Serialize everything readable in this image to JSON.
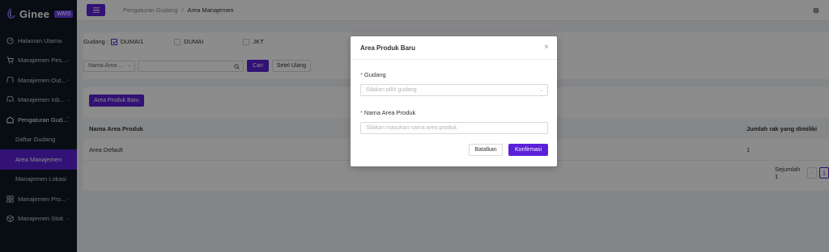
{
  "sidebar": {
    "logo": "Ginee",
    "badge": "WMS",
    "items": [
      {
        "label": "Halaman Utama",
        "icon": "dashboard-icon"
      },
      {
        "label": "Manajemen Pes...",
        "icon": "cart-icon"
      },
      {
        "label": "Manajemen Out...",
        "icon": "outbound-icon"
      },
      {
        "label": "Manajemen Inb...",
        "icon": "inbound-icon"
      },
      {
        "label": "Pengaturan Gud...",
        "icon": "warehouse-icon"
      }
    ],
    "subitems": [
      "Daftar Gudang",
      "Area Manajemen",
      "Manajemen Lokasi"
    ],
    "bottom": [
      {
        "label": "Manajemen Pro...",
        "icon": "product-icon"
      },
      {
        "label": "Manajemen Stok",
        "icon": "stock-icon"
      }
    ]
  },
  "header": {
    "breadcrumb_parent": "Pengaturan Gudang",
    "separator": "/",
    "breadcrumb_current": "Area Manajemen"
  },
  "filter": {
    "warehouse_label": "Gudang :",
    "warehouses": [
      {
        "name": "DUMAI1",
        "checked": true
      },
      {
        "name": "DUMAI",
        "checked": false
      },
      {
        "name": "JKT",
        "checked": false
      }
    ],
    "field_select": "Nama Area ...",
    "search_value": "",
    "search_button": "Cari",
    "reset_button": "Setel Ulang"
  },
  "toolbar": {
    "add_button": "Area Produk Baru"
  },
  "table": {
    "columns": [
      "Nama Area Produk",
      "Jumlah rak yang dimiliki"
    ],
    "rows": [
      [
        "Area Default",
        "1"
      ]
    ],
    "total_label": "Sejumlah 1",
    "page": "1"
  },
  "modal": {
    "title": "Area Produk Baru",
    "warehouse_label": "Gudang",
    "warehouse_placeholder": "Silakan pilih gudang",
    "area_label": "Nama Area Produk",
    "area_placeholder": "Silakan masukan nama area produk",
    "cancel_button": "Batalkan",
    "confirm_button": "Konfirmasi"
  }
}
